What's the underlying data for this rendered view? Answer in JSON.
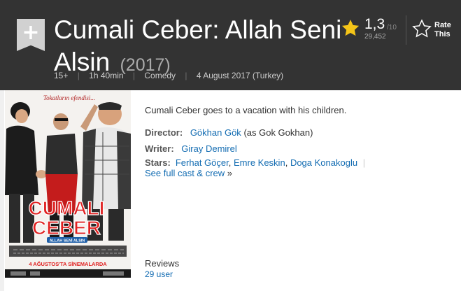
{
  "title_bar": {
    "title": "Cumali Ceber: Allah Seni Alsin",
    "year": "(2017)",
    "watchlist_icon": "plus-icon",
    "subtext": {
      "certificate": "15+",
      "runtime": "1h 40min",
      "genre": "Comedy",
      "release_date": "4 August 2017 (Turkey)"
    },
    "rating": {
      "value": "1,3",
      "best": "/10",
      "count": "29,452"
    },
    "rate_this": {
      "line1": "Rate",
      "line2": "This"
    }
  },
  "poster": {
    "tagline": "Tokatların efendisi...",
    "title_line1": "CUMALI",
    "title_line2": "CEBER",
    "subtitle": "ALLAH SENİ ALSIN",
    "release_text": "4 AĞUSTOS'TA SİNEMALARDA"
  },
  "plot": {
    "summary": "Cumali Ceber goes to a vacation with his children.",
    "director_label": "Director:",
    "director": "Gökhan Gök",
    "director_note": "(as Gok Gokhan)",
    "writer_label": "Writer:",
    "writer": "Giray Demirel",
    "stars_label": "Stars:",
    "stars": [
      "Ferhat Göçer",
      "Emre Keskin",
      "Doga Konakoglu"
    ],
    "stars_sep": ",",
    "pipe": "|",
    "full_cast": "See full cast & crew",
    "full_cast_arrow": "»"
  },
  "reviews": {
    "label": "Reviews",
    "count": "29 user"
  },
  "colors": {
    "header_bg": "#333333",
    "star": "#f5c518",
    "link": "#136cb2",
    "poster_red": "#e02020"
  }
}
